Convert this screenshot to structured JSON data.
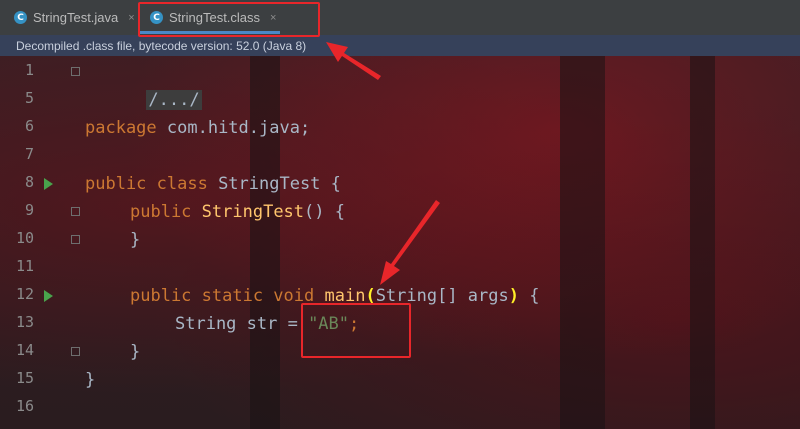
{
  "tabs": [
    {
      "label": "StringTest.java",
      "icon": "c-class-icon",
      "active": false
    },
    {
      "label": "StringTest.class",
      "icon": "c-class-icon",
      "active": true
    }
  ],
  "close_glyph": "×",
  "banner": {
    "text": "Decompiled .class file, bytecode version: 52.0 (Java 8)"
  },
  "gutter": {
    "line_numbers": [
      "1",
      "5",
      "6",
      "7",
      "8",
      "9",
      "10",
      "11",
      "12",
      "13",
      "14",
      "15",
      "16"
    ]
  },
  "code": {
    "line1": "/.../",
    "line6_kw": "package",
    "line6_rest": " com.hitd.java;",
    "line8_kw": "public class",
    "line8_name": " StringTest {",
    "line9_kw": "public",
    "line9_ctor": "StringTest",
    "line9_rest": "() {",
    "line10": "}",
    "line12_kw": "public static void",
    "line12_method": "main",
    "line12_paren_open": "(",
    "line12_params": "String[] args",
    "line12_paren_close": ")",
    "line12_brace": " {",
    "line13_type": "String str = ",
    "line13_str": "\"AB\"",
    "line13_semi": ";",
    "line14": "}",
    "line15": "}"
  },
  "colors": {
    "annotation": "#e8262a",
    "keyword": "#cc7832",
    "string": "#6a8759",
    "method": "#ffc66d"
  }
}
